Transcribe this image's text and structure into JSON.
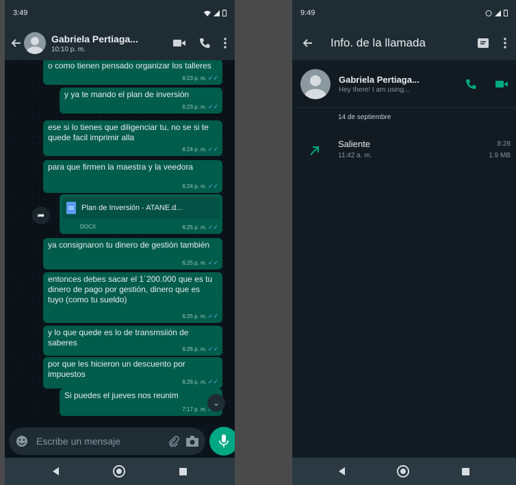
{
  "left_screen": {
    "status_time": "3:49",
    "contact_name": "Gabriela Pertiaga...",
    "contact_status": "10:10 p. m.",
    "messages": [
      {
        "text": "o como tienen pensado organizar los talleres",
        "time": "6:23 p. m."
      },
      {
        "text": "y ya te mando el plan de inversión",
        "time": "6:23 p. m."
      },
      {
        "text": "ese si lo tienes que diligenciar tu, no se si te quede facil imprimir alla",
        "time": "6:24 p. m."
      },
      {
        "text": "para que firmen la maestra y la veedora",
        "time": "6:24 p. m."
      },
      {
        "text": "ya consignaron tu dinero de gestión también",
        "time": "6:25 p. m."
      },
      {
        "text": "entonces debes sacar el 1´200.000 que es tu dinero de pago por gestión, dinero que es tuyo (como tu sueldo)",
        "time": "6:25 p. m."
      },
      {
        "text": "y lo que quede es lo de transmsiión de saberes",
        "time": "6:26 p. m."
      },
      {
        "text": "por que les hicieron un descuento por impuestos",
        "time": "6:26 p. m."
      },
      {
        "text": "Si puedes el jueves nos reunim",
        "time": "7:17 p. m."
      }
    ],
    "document": {
      "name": "Plan de Inversión - ATANE.d...",
      "type": "DOCX",
      "time": "6:25 p. m."
    },
    "input_placeholder": "Escribe un mensaje"
  },
  "right_screen": {
    "status_time": "9:49",
    "title": "Info. de la llamada",
    "contact_name": "Gabriela Pertiaga...",
    "contact_about": "Hey there! I am using...",
    "date_header": "14 de septiembre",
    "call": {
      "direction": "Saliente",
      "time": "11:42 a. m.",
      "duration": "8:28",
      "size": "1.9 MB"
    }
  },
  "colors": {
    "accent": "#00a884",
    "bubble": "#005c4b",
    "read_ticks": "#53bdeb",
    "background": "#0b141a"
  }
}
